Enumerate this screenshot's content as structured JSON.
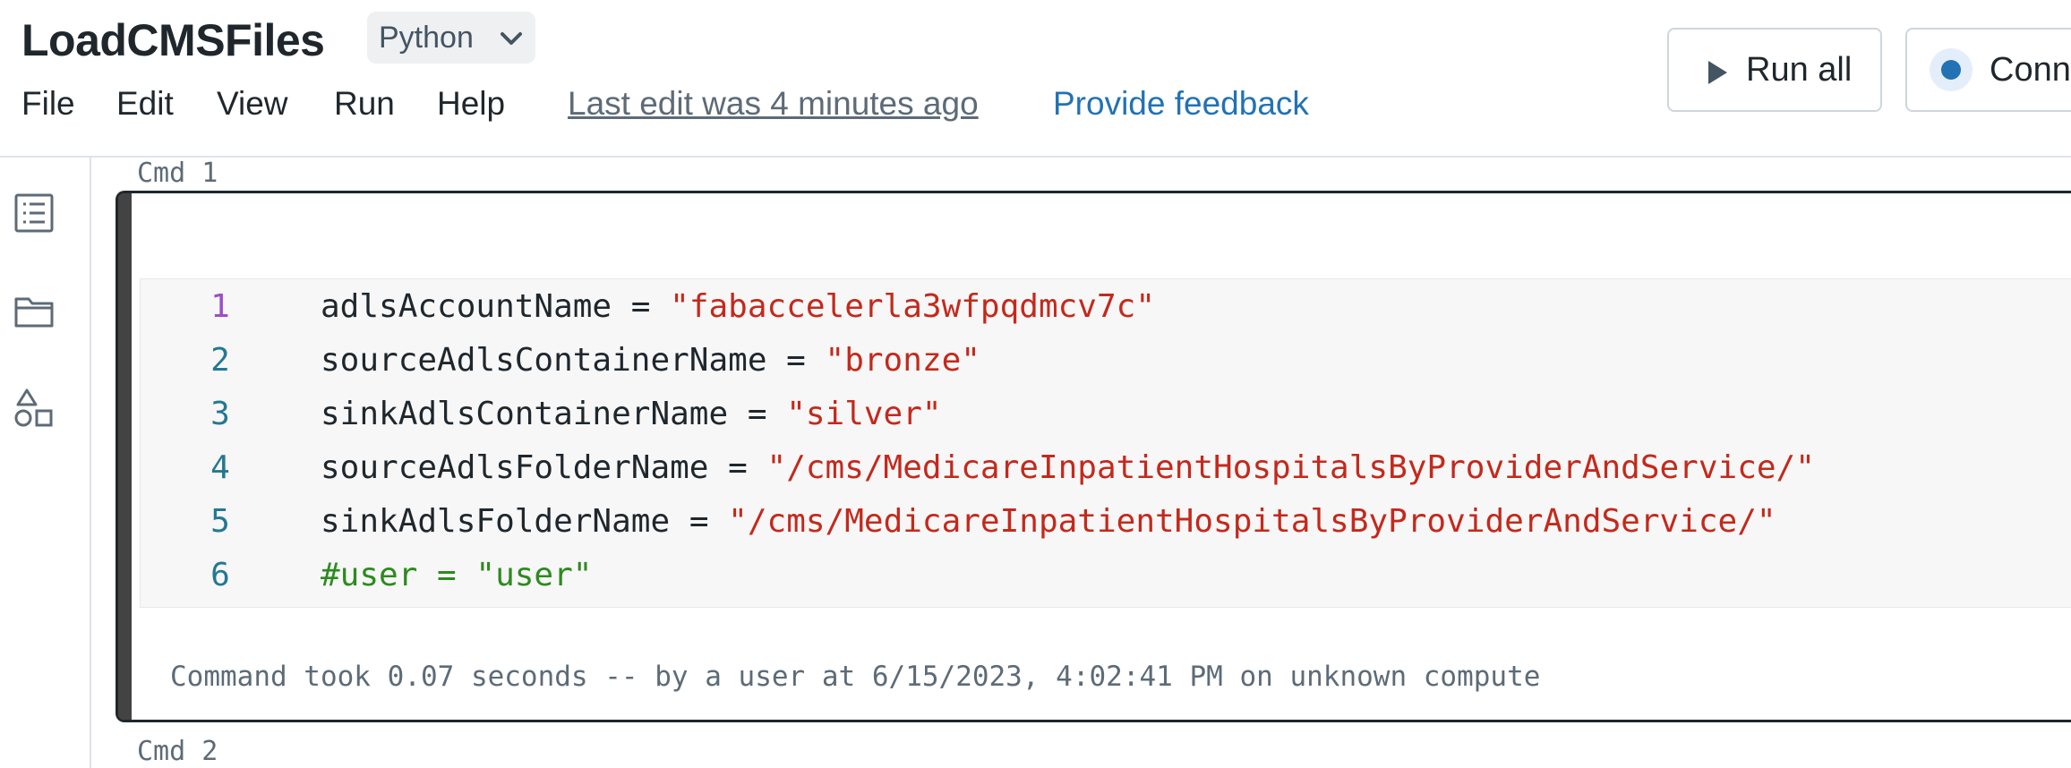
{
  "notebook": {
    "title": "LoadCMSFiles",
    "language": "Python"
  },
  "menu": {
    "file": "File",
    "edit": "Edit",
    "view": "View",
    "run": "Run",
    "help": "Help"
  },
  "header": {
    "last_edit": "Last edit was 4 minutes ago",
    "feedback": "Provide feedback",
    "run_all": "Run all",
    "connect": "Conn"
  },
  "cells": [
    {
      "label": "Cmd 1",
      "lines": [
        {
          "num": "1",
          "var": "adlsAccountName",
          "op": " = ",
          "str": "\"fabaccelerla3wfpqdmcv7c\""
        },
        {
          "num": "2",
          "var": "sourceAdlsContainerName",
          "op": " = ",
          "str": "\"bronze\""
        },
        {
          "num": "3",
          "var": "sinkAdlsContainerName",
          "op": " = ",
          "str": "\"silver\""
        },
        {
          "num": "4",
          "var": "sourceAdlsFolderName",
          "op": " = ",
          "str": "\"/cms/MedicareInpatientHospitalsByProviderAndService/\""
        },
        {
          "num": "5",
          "var": "sinkAdlsFolderName",
          "op": " = ",
          "str": "\"/cms/MedicareInpatientHospitalsByProviderAndService/\""
        },
        {
          "num": "6",
          "comment": "#user = \"user\""
        }
      ],
      "output": "Command took 0.07 seconds -- by a user at 6/15/2023, 4:02:41 PM on unknown compute"
    },
    {
      "label": "Cmd 2"
    }
  ],
  "icons": {
    "toc": "list-icon",
    "files": "folder-icon",
    "shapes": "shapes-icon",
    "play": "play-icon",
    "chevron": "chevron-down-icon"
  },
  "colors": {
    "accent_blue": "#2272b4",
    "string_red": "#c4291c",
    "comment_green": "#2d8a1f",
    "line_number": "#237893",
    "active_line_number": "#9b4dca"
  }
}
